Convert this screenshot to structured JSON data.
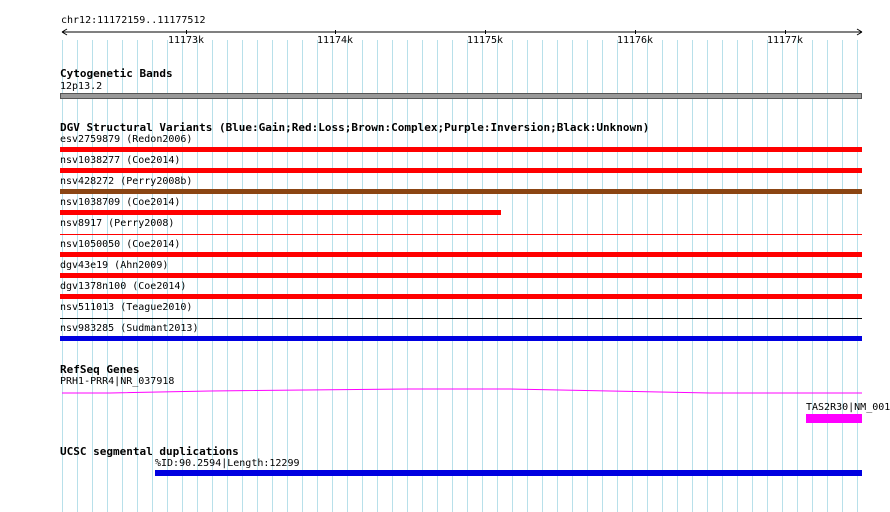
{
  "locus": "chr12:11172159..11177512",
  "ruler_ticks": [
    "11173k",
    "11174k",
    "11175k",
    "11176k",
    "11177k"
  ],
  "tracks": {
    "cyto": {
      "title": "Cytogenetic Bands",
      "band_label": "12p13.2",
      "band_color": "#999999"
    },
    "dgv": {
      "title": "DGV Structural Variants (Blue:Gain;Red:Loss;Brown:Complex;Purple:Inversion;Black:Unknown)",
      "features": [
        {
          "label": "esv2759879 (Redon2006)",
          "color": "#ff0000"
        },
        {
          "label": "nsv1038277 (Coe2014)",
          "color": "#ff0000"
        },
        {
          "label": "nsv428272 (Perry2008b)",
          "color": "#8b4513"
        },
        {
          "label": "nsv1038709 (Coe2014)",
          "color": "#ff0000"
        },
        {
          "label": "nsv8917 (Perry2008)",
          "color": "#ff0000"
        },
        {
          "label": "nsv1050050 (Coe2014)",
          "color": "#ff0000"
        },
        {
          "label": "dgv43e19 (Ahn2009)",
          "color": "#ff0000"
        },
        {
          "label": "dgv1378n100 (Coe2014)",
          "color": "#ff0000"
        },
        {
          "label": "nsv511013 (Teague2010)",
          "color": "#000000"
        },
        {
          "label": "nsv983285 (Sudmant2013)",
          "color": "#0000e0"
        }
      ]
    },
    "refseq": {
      "title": "RefSeq Genes",
      "gene1_label": "PRH1-PRR4|NR_037918",
      "gene2_label": "TAS2R30|NM_001",
      "gene_color": "#ff00ff"
    },
    "segdup": {
      "title": "UCSC segmental duplications",
      "label": "%ID:90.2594|Length:12299",
      "color": "#0000e0"
    }
  }
}
